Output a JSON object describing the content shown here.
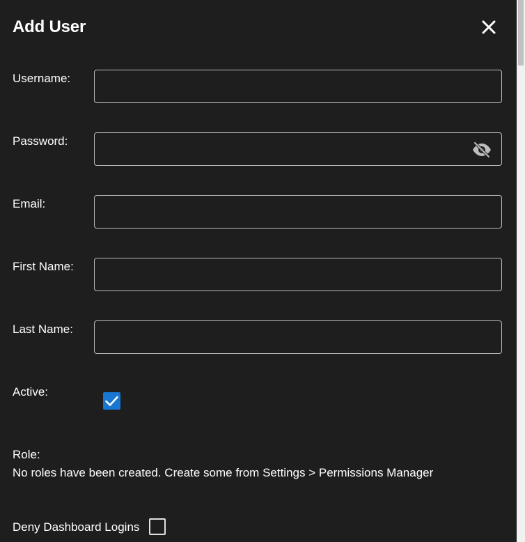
{
  "dialog": {
    "title": "Add User",
    "close_icon": "close-icon"
  },
  "fields": {
    "username": {
      "label": "Username:",
      "value": ""
    },
    "password": {
      "label": "Password:",
      "value": "",
      "toggle_icon": "eye-off-icon"
    },
    "email": {
      "label": "Email:",
      "value": ""
    },
    "first_name": {
      "label": "First Name:",
      "value": ""
    },
    "last_name": {
      "label": "Last Name:",
      "value": ""
    }
  },
  "active": {
    "label": "Active:",
    "checked": true,
    "accent_color": "#1976d2"
  },
  "role": {
    "label": "Role:",
    "message": "No roles have been created. Create some from Settings > Permissions Manager"
  },
  "deny_dashboard": {
    "label": "Deny Dashboard Logins",
    "checked": false
  },
  "colors": {
    "background": "#1e1e1e",
    "text": "#ffffff",
    "border": "#bdbdbd"
  }
}
